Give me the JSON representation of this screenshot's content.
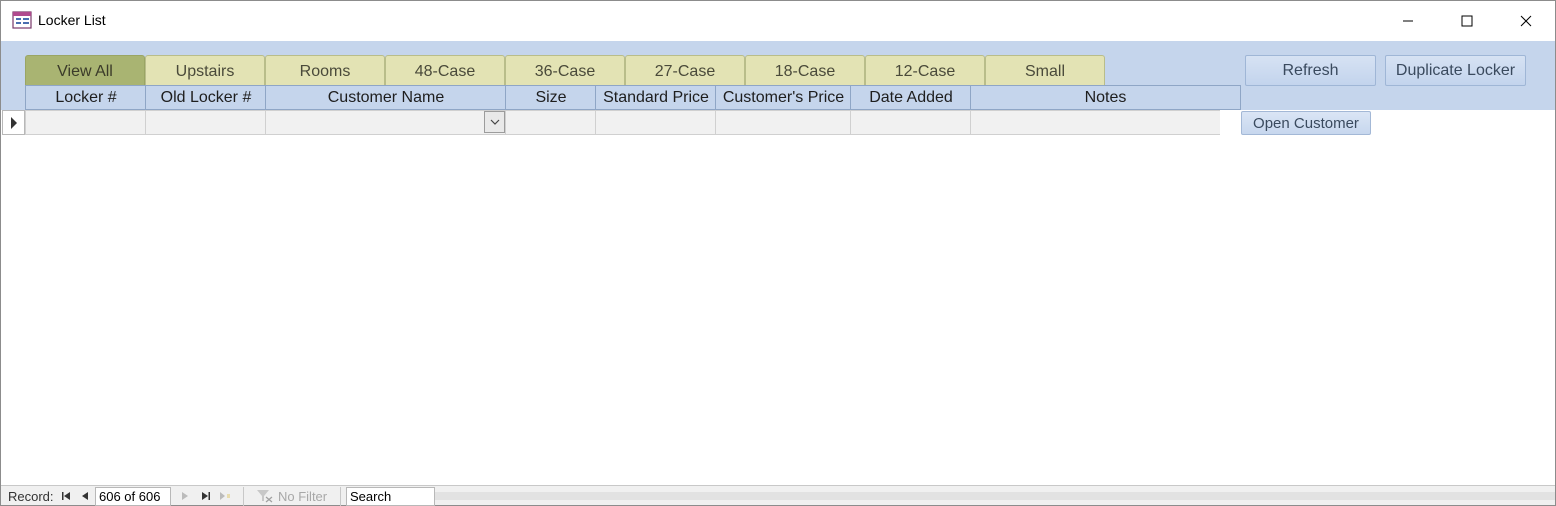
{
  "window": {
    "title": "Locker List"
  },
  "tabs": [
    {
      "label": "View All",
      "active": true
    },
    {
      "label": "Upstairs",
      "active": false
    },
    {
      "label": "Rooms",
      "active": false
    },
    {
      "label": "48-Case",
      "active": false
    },
    {
      "label": "36-Case",
      "active": false
    },
    {
      "label": "27-Case",
      "active": false
    },
    {
      "label": "18-Case",
      "active": false
    },
    {
      "label": "12-Case",
      "active": false
    },
    {
      "label": "Small",
      "active": false
    }
  ],
  "buttons": {
    "refresh": "Refresh",
    "duplicate": "Duplicate Locker",
    "open_customer": "Open Customer"
  },
  "columns": [
    "Locker #",
    "Old Locker #",
    "Customer Name",
    "Size",
    "Standard Price",
    "Customer's Price",
    "Date Added",
    "Notes"
  ],
  "row": {
    "locker": "",
    "old_locker": "",
    "customer_name": "",
    "size": "",
    "standard_price": "",
    "customer_price": "",
    "date_added": "",
    "notes": ""
  },
  "navigation": {
    "record_label": "Record:",
    "position": "606 of 606",
    "filter_label": "No Filter",
    "search_placeholder": "Search"
  },
  "colors": {
    "header_band": "#c5d5ec",
    "tab": "#e3e3b4",
    "tab_active": "#a9b472"
  },
  "icons": [
    "app-form-icon",
    "minimize-icon",
    "maximize-icon",
    "close-icon",
    "chevron-down-icon",
    "first-record-icon",
    "prev-record-icon",
    "next-record-icon",
    "last-record-icon",
    "new-record-icon",
    "filter-off-icon"
  ]
}
